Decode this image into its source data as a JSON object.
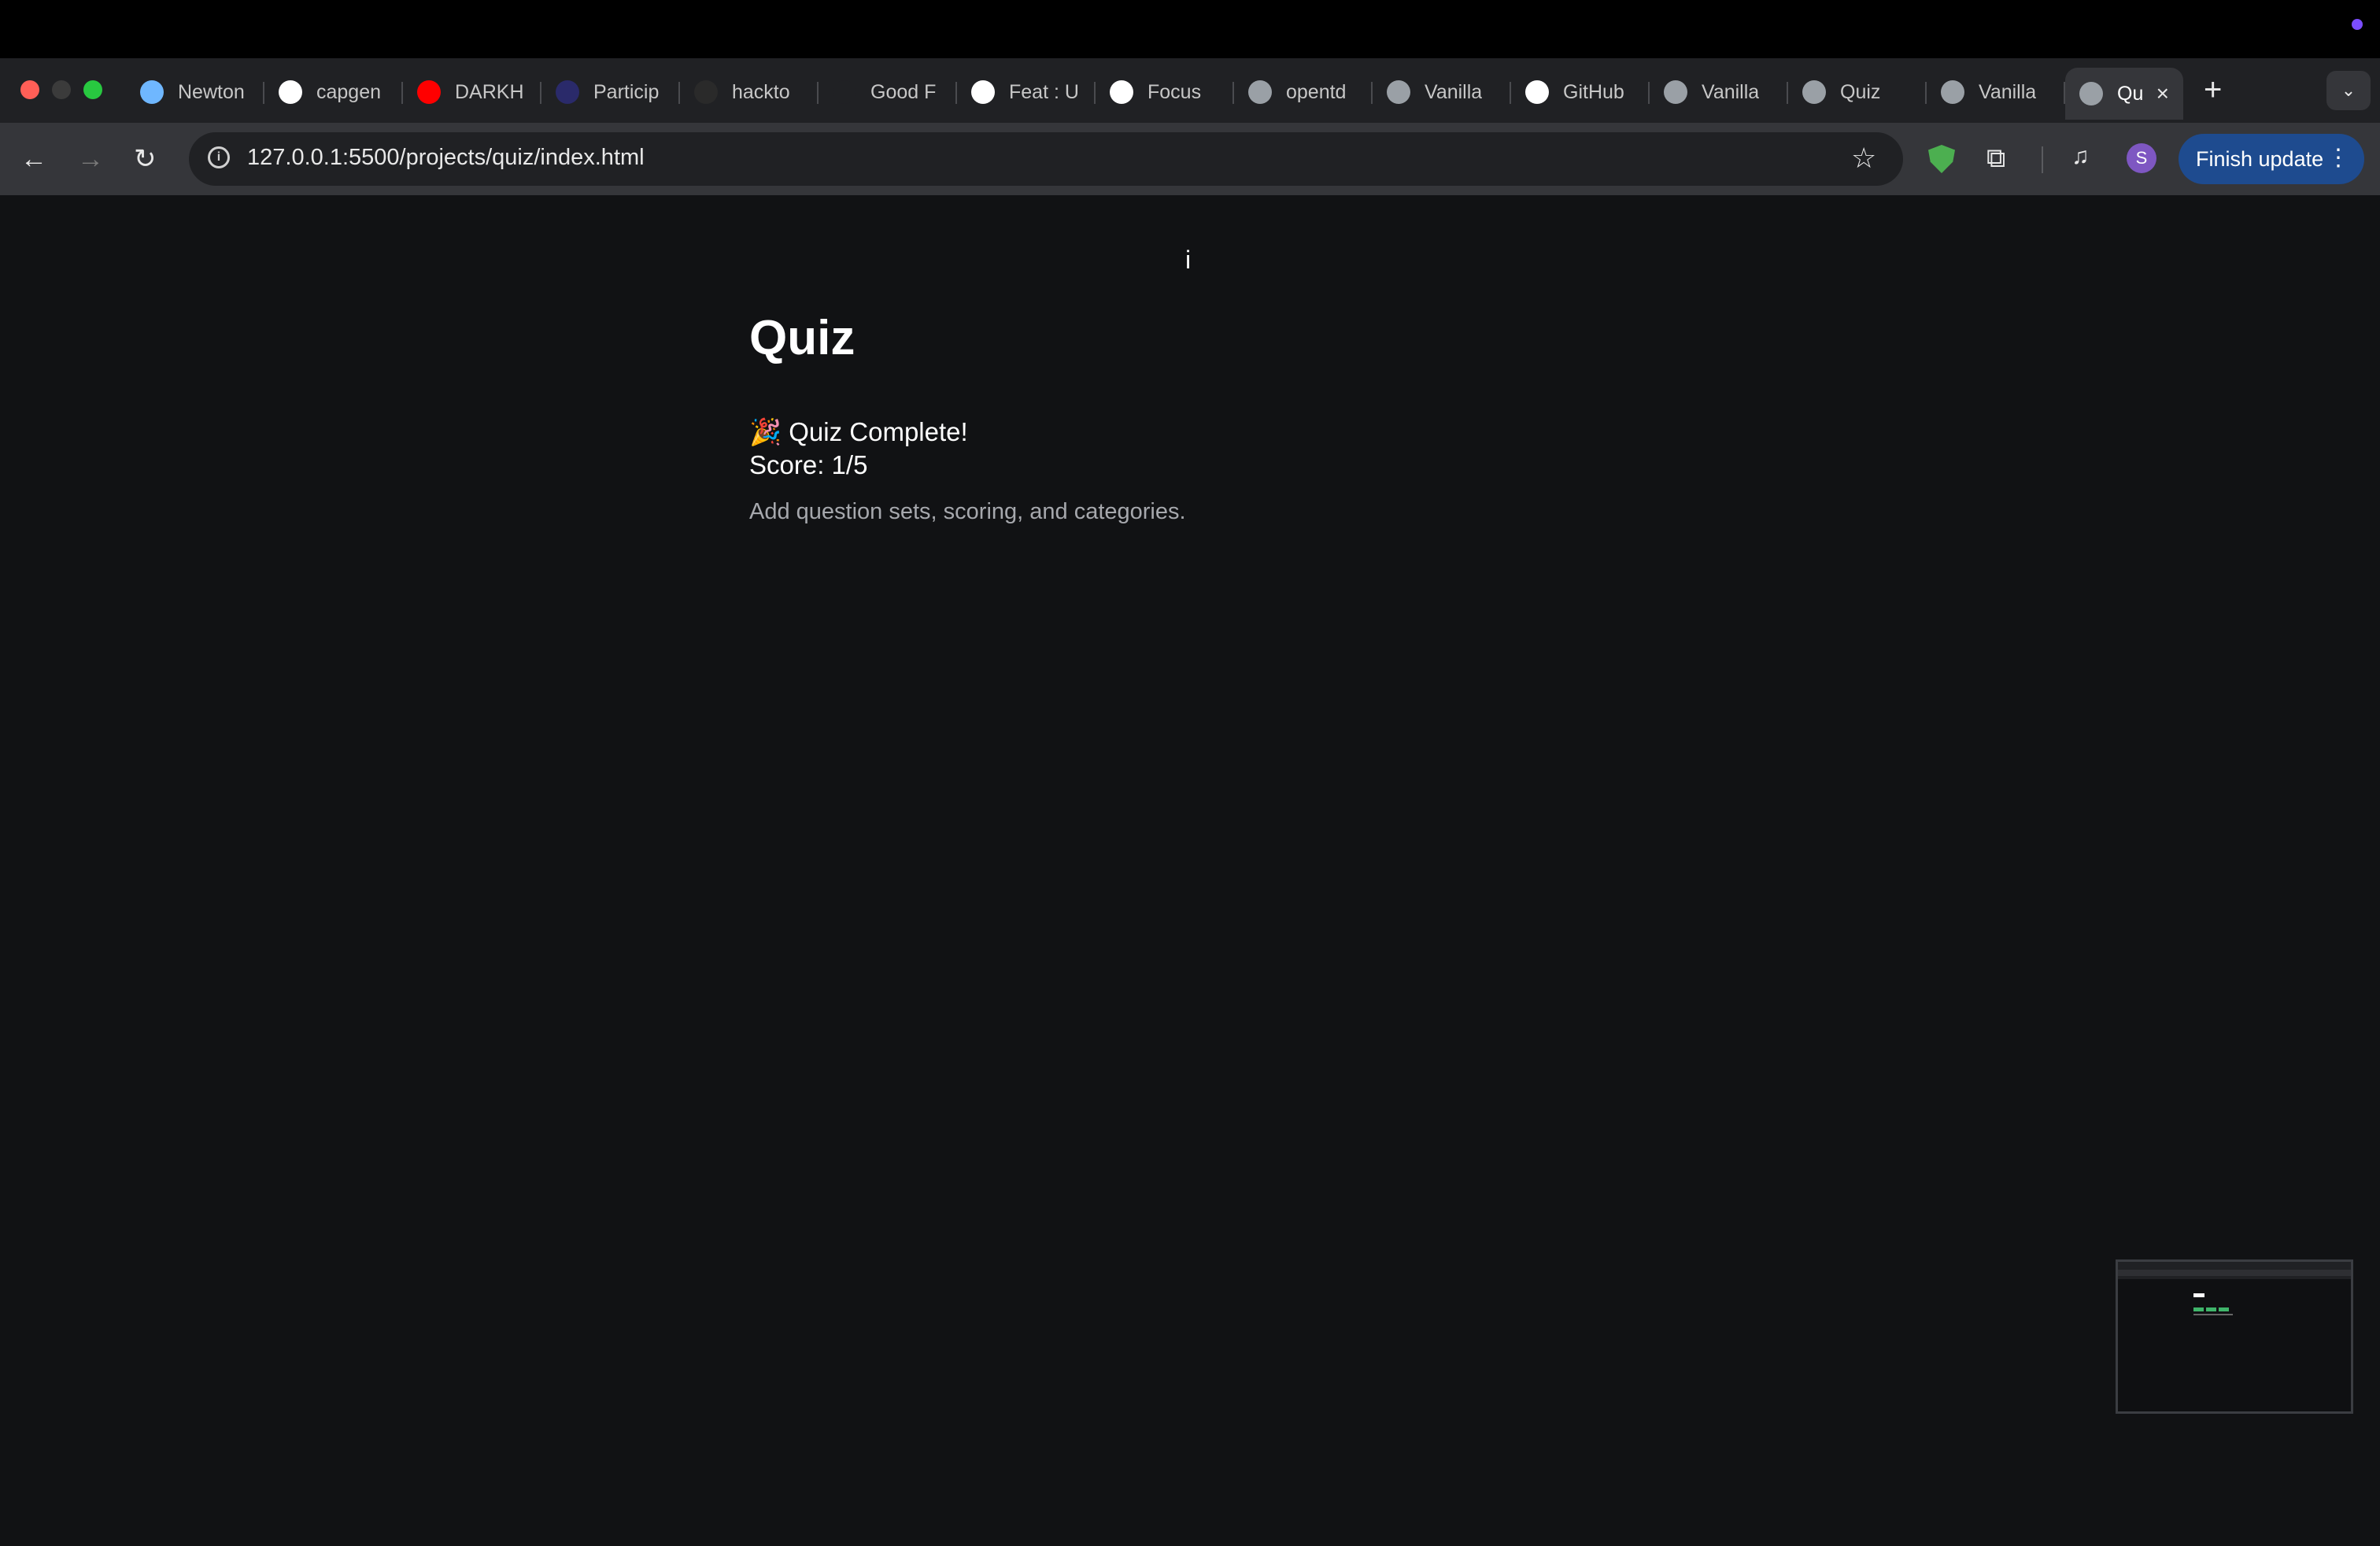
{
  "browser": {
    "tabs": [
      {
        "label": "Newton",
        "icon": "newton-icon",
        "color": "#6fb7ff"
      },
      {
        "label": "capgen",
        "icon": "google-icon",
        "color": "#ffffff"
      },
      {
        "label": "DARKH",
        "icon": "youtube-icon",
        "color": "#ff0000"
      },
      {
        "label": "Particip",
        "icon": "hf-icon",
        "color": "#2a2a6a"
      },
      {
        "label": "hackto",
        "icon": "circle-icon",
        "color": "#2a2a2a"
      },
      {
        "label": "Good F",
        "icon": "gfi-icon",
        "color": "#202124"
      },
      {
        "label": "Feat : U",
        "icon": "github-icon",
        "color": "#ffffff"
      },
      {
        "label": "Focus",
        "icon": "openai-icon",
        "color": "#ffffff"
      },
      {
        "label": "opentd",
        "icon": "globe-icon",
        "color": "#9aa0a6"
      },
      {
        "label": "Vanilla",
        "icon": "globe-icon",
        "color": "#9aa0a6"
      },
      {
        "label": "GitHub",
        "icon": "github-icon",
        "color": "#ffffff"
      },
      {
        "label": "Vanilla",
        "icon": "globe-icon",
        "color": "#9aa0a6"
      },
      {
        "label": "Quiz",
        "icon": "globe-icon",
        "color": "#9aa0a6"
      },
      {
        "label": "Vanilla",
        "icon": "globe-icon",
        "color": "#9aa0a6"
      }
    ],
    "active_tab": {
      "label": "Qu",
      "icon": "globe-icon",
      "close_icon": "×"
    },
    "new_tab": "+",
    "tab_search_icon": "⌄",
    "url": "127.0.0.1:5500/projects/quiz/index.html",
    "avatar_initial": "S",
    "update_label": "Finish update",
    "kebab": "⋮"
  },
  "page": {
    "cursor": "i",
    "title": "Quiz",
    "complete_text": "🎉 Quiz Complete!",
    "score_text": "Score: 1/5",
    "hint": "Add question sets, scoring, and categories."
  }
}
